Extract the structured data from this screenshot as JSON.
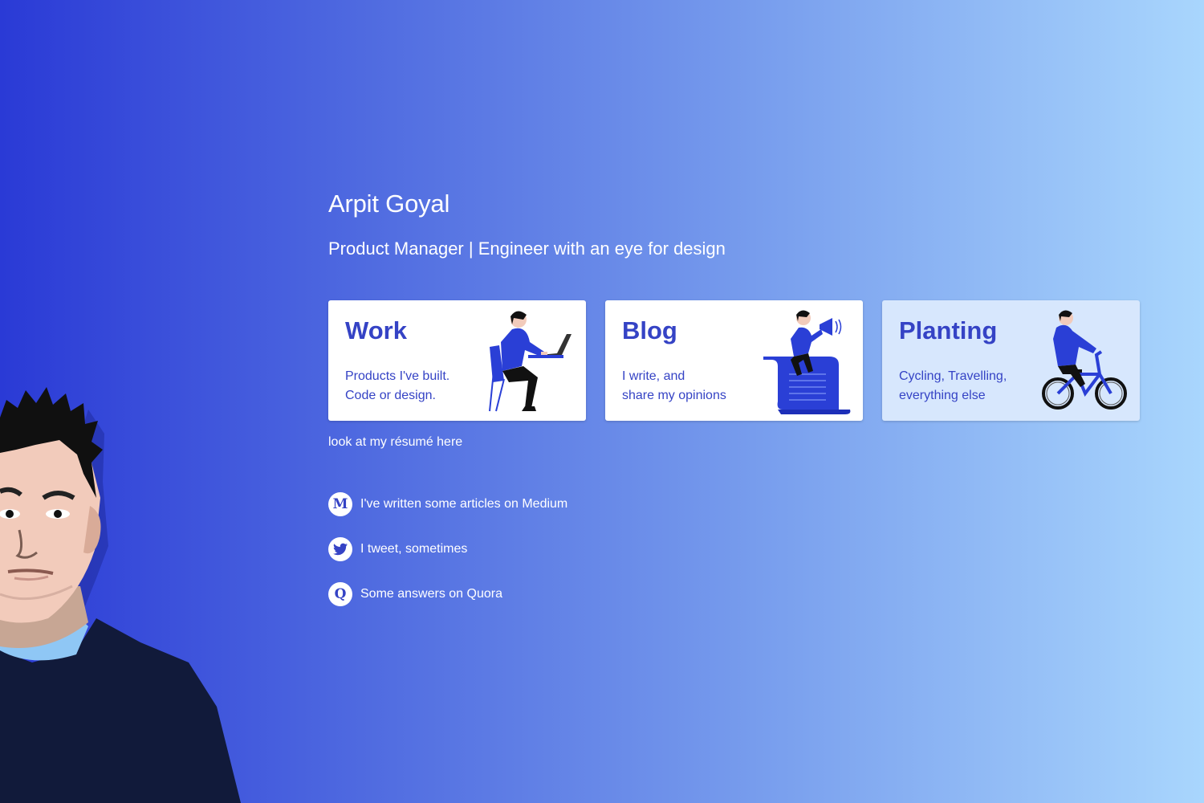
{
  "profile": {
    "name": "Arpit Goyal",
    "tagline": "Product Manager | Engineer with an eye for design"
  },
  "cards": [
    {
      "title": "Work",
      "lines": [
        "Products I've built.",
        "Code or design."
      ],
      "art": "person-at-laptop-illustration"
    },
    {
      "title": "Blog",
      "lines": [
        "I write, and",
        "share my opinions"
      ],
      "art": "person-with-megaphone-illustration"
    },
    {
      "title": "Planting",
      "lines": [
        "Cycling, Travelling,",
        "everything else"
      ],
      "art": "person-on-bicycle-illustration"
    }
  ],
  "resume_link": "look at my résumé here",
  "social": [
    {
      "icon": "medium-icon",
      "glyph": "M",
      "label": "I've written some articles on Medium"
    },
    {
      "icon": "twitter-icon",
      "glyph": "",
      "label": "I tweet, sometimes"
    },
    {
      "icon": "quora-icon",
      "glyph": "Q",
      "label": "Some answers on Quora"
    }
  ],
  "colors": {
    "accent": "#3543c5",
    "gradient_start": "#2a3ad6",
    "gradient_end": "#a9d6fd",
    "illustration_blue": "#2a3fd6",
    "shirt_dark": "#111a3a"
  }
}
